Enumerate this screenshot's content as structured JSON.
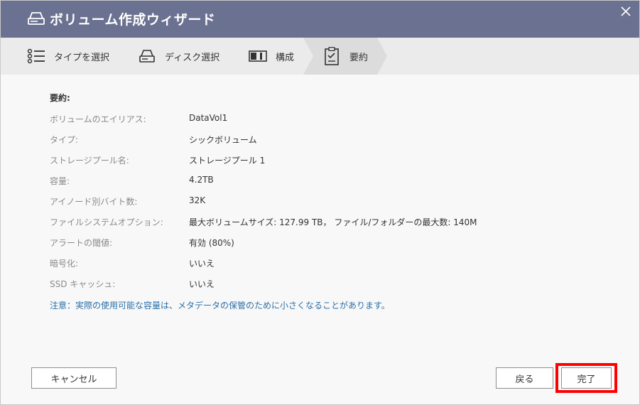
{
  "window": {
    "title": "ボリューム作成ウィザード",
    "title_icon": "drive-icon",
    "close_icon": "close-icon",
    "colors": {
      "titlebar": "#6b7190",
      "stepbar": "#ebebeb",
      "active_step": "#dcdcdc",
      "note": "#2a6fa8",
      "highlight": "#ff0000"
    }
  },
  "steps": [
    {
      "label": "タイプを選択",
      "icon": "list-icon"
    },
    {
      "label": "ディスク選択",
      "icon": "disk-icon"
    },
    {
      "label": "構成",
      "icon": "config-icon"
    },
    {
      "label": "要約",
      "icon": "clipboard-check-icon",
      "active": true
    }
  ],
  "summary": {
    "heading": "要約:",
    "rows": [
      {
        "key": "ボリュームのエイリアス:",
        "value": "DataVol1"
      },
      {
        "key": "タイプ:",
        "value": "シックボリューム"
      },
      {
        "key": "ストレージプール名:",
        "value": "ストレージプール 1"
      },
      {
        "key": "容量:",
        "value": "4.2TB"
      },
      {
        "key": "アイノード別バイト数:",
        "value": "32K"
      },
      {
        "key": "ファイルシステムオプション:",
        "value": "最大ボリュームサイズ: 127.99 TB， ファイル/フォルダーの最大数: 140M"
      },
      {
        "key": "アラートの閾値:",
        "value": "有効 (80%)"
      },
      {
        "key": "暗号化:",
        "value": "いいえ"
      },
      {
        "key": "SSD キャッシュ:",
        "value": "いいえ"
      }
    ],
    "note": "注意：実際の使用可能な容量は、メタデータの保管のために小さくなることがあります。"
  },
  "buttons": {
    "cancel": "キャンセル",
    "back": "戻る",
    "finish": "完了"
  }
}
